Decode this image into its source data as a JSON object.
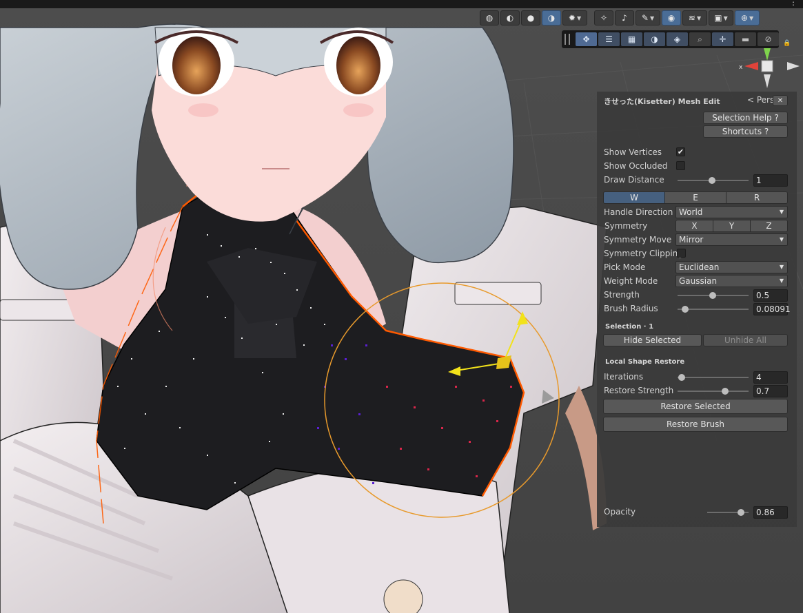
{
  "toolbar": {
    "icons": [
      "wireframe-shading-icon",
      "shaded-wireframe-icon",
      "shaded-icon",
      "unlit-shading-icon",
      "debug-draw-mode-icon",
      "lighting-toggle-icon",
      "audio-toggle-icon",
      "effects-toggle-icon",
      "visibility-toggle-icon",
      "layers-icon",
      "camera-settings-icon",
      "gizmos-icon"
    ]
  },
  "tools": {
    "icons": [
      "move-tool-icon",
      "vertex-snap-icon",
      "uv-grid-icon",
      "shading-tool-icon",
      "layer-tool-icon",
      "search-icon",
      "pivot-tool-icon",
      "camera-tool-icon",
      "gizmo-tool-icon"
    ]
  },
  "gizmo": {
    "x_label": "x",
    "persp_label": "< Persp"
  },
  "panel": {
    "title": "きせった(Kisetter) Mesh Edit",
    "close": "✕",
    "help_button": "Selection Help ?",
    "shortcuts_button": "Shortcuts ?",
    "show_vertices": {
      "label": "Show Vertices",
      "checked": true,
      "mark": "✔"
    },
    "show_occluded": {
      "label": "Show Occluded",
      "checked": false
    },
    "draw_distance": {
      "label": "Draw Distance",
      "value": "1",
      "slider": 0.55
    },
    "mode_tabs": [
      {
        "label": "W",
        "active": true
      },
      {
        "label": "E",
        "active": false
      },
      {
        "label": "R",
        "active": false
      }
    ],
    "handle_direction": {
      "label": "Handle Direction",
      "value": "World"
    },
    "symmetry": {
      "label": "Symmetry",
      "axes": [
        "X",
        "Y",
        "Z"
      ]
    },
    "symmetry_move": {
      "label": "Symmetry Move",
      "value": "Mirror"
    },
    "symmetry_clipping": {
      "label": "Symmetry Clipping",
      "checked": false
    },
    "pick_mode": {
      "label": "Pick Mode",
      "value": "Euclidean"
    },
    "weight_mode": {
      "label": "Weight Mode",
      "value": "Gaussian"
    },
    "strength": {
      "label": "Strength",
      "value": "0.5",
      "slider": 0.5
    },
    "brush_radius": {
      "label": "Brush Radius",
      "value": "0.08091",
      "slider": 0.04
    },
    "selection_header": "Selection · 1",
    "hide_selected": "Hide Selected",
    "unhide_all": "Unhide All",
    "restore_header": "Local Shape Restore",
    "iterations": {
      "label": "Iterations",
      "value": "4",
      "slider": 0.0
    },
    "restore_strength": {
      "label": "Restore Strength",
      "value": "0.7",
      "slider": 0.7
    },
    "restore_selected": "Restore Selected",
    "restore_brush": "Restore Brush",
    "opacity": {
      "label": "Opacity",
      "value": "0.86",
      "slider": 0.86
    }
  },
  "colors": {
    "accent_blue": "#4a6d97",
    "brush_circle": "#e89a2c",
    "gizmo_yellow": "#f2e21a",
    "selection_orange": "#ff5a00"
  }
}
